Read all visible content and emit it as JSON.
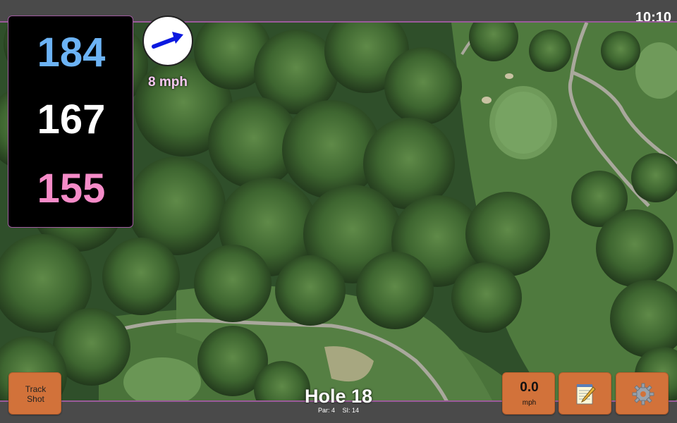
{
  "clock": "10:10",
  "distances": {
    "back": "184",
    "middle": "167",
    "front": "155"
  },
  "wind": {
    "speed_label": "8 mph",
    "icon": "wind-arrow-icon",
    "arrow_color": "#0b19e0"
  },
  "hole": {
    "title": "Hole 18",
    "par_label": "Par: 4",
    "si_label": "SI: 14"
  },
  "buttons": {
    "track_shot": "Track Shot",
    "speed_value": "0.0",
    "speed_unit": "mph",
    "notes_icon": "notepad-icon",
    "settings_icon": "gear-icon"
  },
  "colors": {
    "back": "#6cb3f5",
    "middle": "#ffffff",
    "front": "#f58bc8",
    "button": "#d2723a",
    "frame": "#a05aa0"
  }
}
